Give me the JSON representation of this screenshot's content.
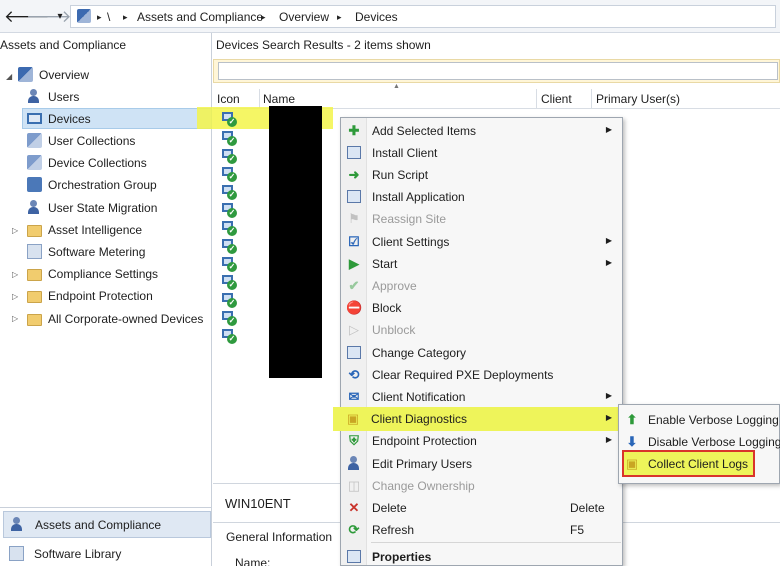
{
  "breadcrumb": {
    "root_sep": "\\",
    "items": [
      "Assets and Compliance",
      "Overview",
      "Devices"
    ]
  },
  "nav": {
    "back": "🡐",
    "forward": "🡒",
    "dropdown": "▾"
  },
  "left_panel": {
    "header": "Assets and Compliance",
    "tree": [
      {
        "label": "Overview"
      },
      {
        "label": "Users"
      },
      {
        "label": "Devices"
      },
      {
        "label": "User Collections"
      },
      {
        "label": "Device Collections"
      },
      {
        "label": "Orchestration Group"
      },
      {
        "label": "User State Migration"
      },
      {
        "label": "Asset Intelligence"
      },
      {
        "label": "Software Metering"
      },
      {
        "label": "Compliance Settings"
      },
      {
        "label": "Endpoint Protection"
      },
      {
        "label": "All Corporate-owned Devices"
      }
    ],
    "workspaces": [
      "Assets and Compliance",
      "Software Library"
    ]
  },
  "main": {
    "title": "Devices Search Results",
    "separator": " - ",
    "count": "2 items shown",
    "search_placeholder": "",
    "columns": [
      "Icon",
      "Name",
      "Client",
      "Primary User(s)"
    ]
  },
  "details": {
    "device_name": "WIN10ENT",
    "tab": "General Information",
    "field": "Name:"
  },
  "context_menu": [
    {
      "label": "Add Selected Items",
      "submenu": true
    },
    {
      "label": "Install Client"
    },
    {
      "label": "Run Script"
    },
    {
      "label": "Install Application"
    },
    {
      "label": "Reassign Site",
      "disabled": true
    },
    {
      "label": "Client Settings",
      "submenu": true
    },
    {
      "label": "Start",
      "submenu": true
    },
    {
      "label": "Approve",
      "disabled": true
    },
    {
      "label": "Block"
    },
    {
      "label": "Unblock",
      "disabled": true
    },
    {
      "label": "Change Category"
    },
    {
      "label": "Clear Required PXE Deployments"
    },
    {
      "label": "Client Notification",
      "submenu": true
    },
    {
      "label": "Client Diagnostics",
      "submenu": true
    },
    {
      "label": "Endpoint Protection",
      "submenu": true
    },
    {
      "label": "Edit Primary Users"
    },
    {
      "label": "Change Ownership",
      "disabled": true
    },
    {
      "label": "Delete",
      "shortcut": "Delete"
    },
    {
      "label": "Refresh",
      "shortcut": "F5"
    },
    {
      "label": "Properties"
    }
  ],
  "submenu": [
    "Enable Verbose Logging",
    "Disable Verbose Logging",
    "Collect Client Logs"
  ],
  "colors": {
    "highlight": "#eef45a",
    "red_box": "#d9342b",
    "selection": "#cfe3f5"
  }
}
